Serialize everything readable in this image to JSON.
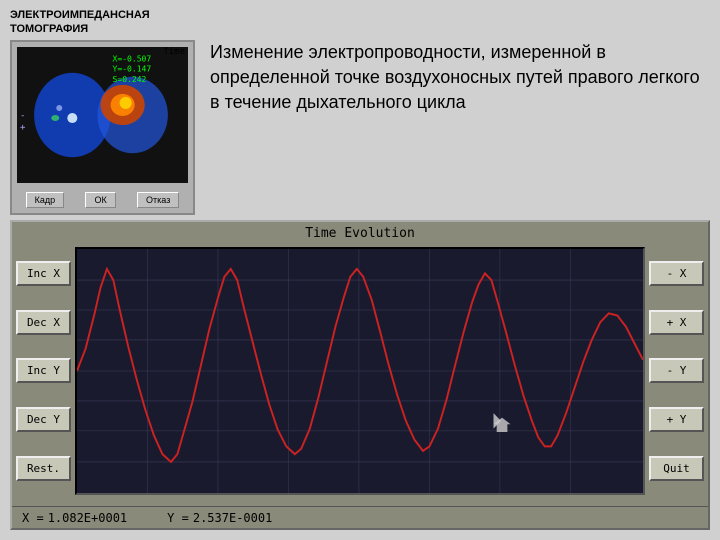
{
  "header": {
    "line1": "ЭЛЕКТРОИМПЕДАНСНАЯ",
    "line2": "ТОМОГРАФИЯ"
  },
  "eit_panel": {
    "x_val": "X=-0.507",
    "y_val": "Y=-0.147",
    "s_val": "S=0.242",
    "time_label": "Time",
    "btn_frame": "Кадр",
    "btn_ok": "ОК",
    "btn_cancel": "Отказ"
  },
  "description": "Изменение электропроводности, измеренной  в определенной точке воздухоносных путей  правого легкого в течение дыхательного цикла",
  "evolution_panel": {
    "title": "Time Evolution",
    "buttons_left": [
      "Inc X",
      "Dec X",
      "Inc Y",
      "Dec Y",
      "Rest."
    ],
    "buttons_right": [
      "- X",
      "+ X",
      "- Y",
      "+ Y",
      "Quit"
    ]
  },
  "status_bar": {
    "x_label": "X =",
    "x_value": "1.082E+0001",
    "y_label": "Y =",
    "y_value": "2.537E-0001"
  }
}
